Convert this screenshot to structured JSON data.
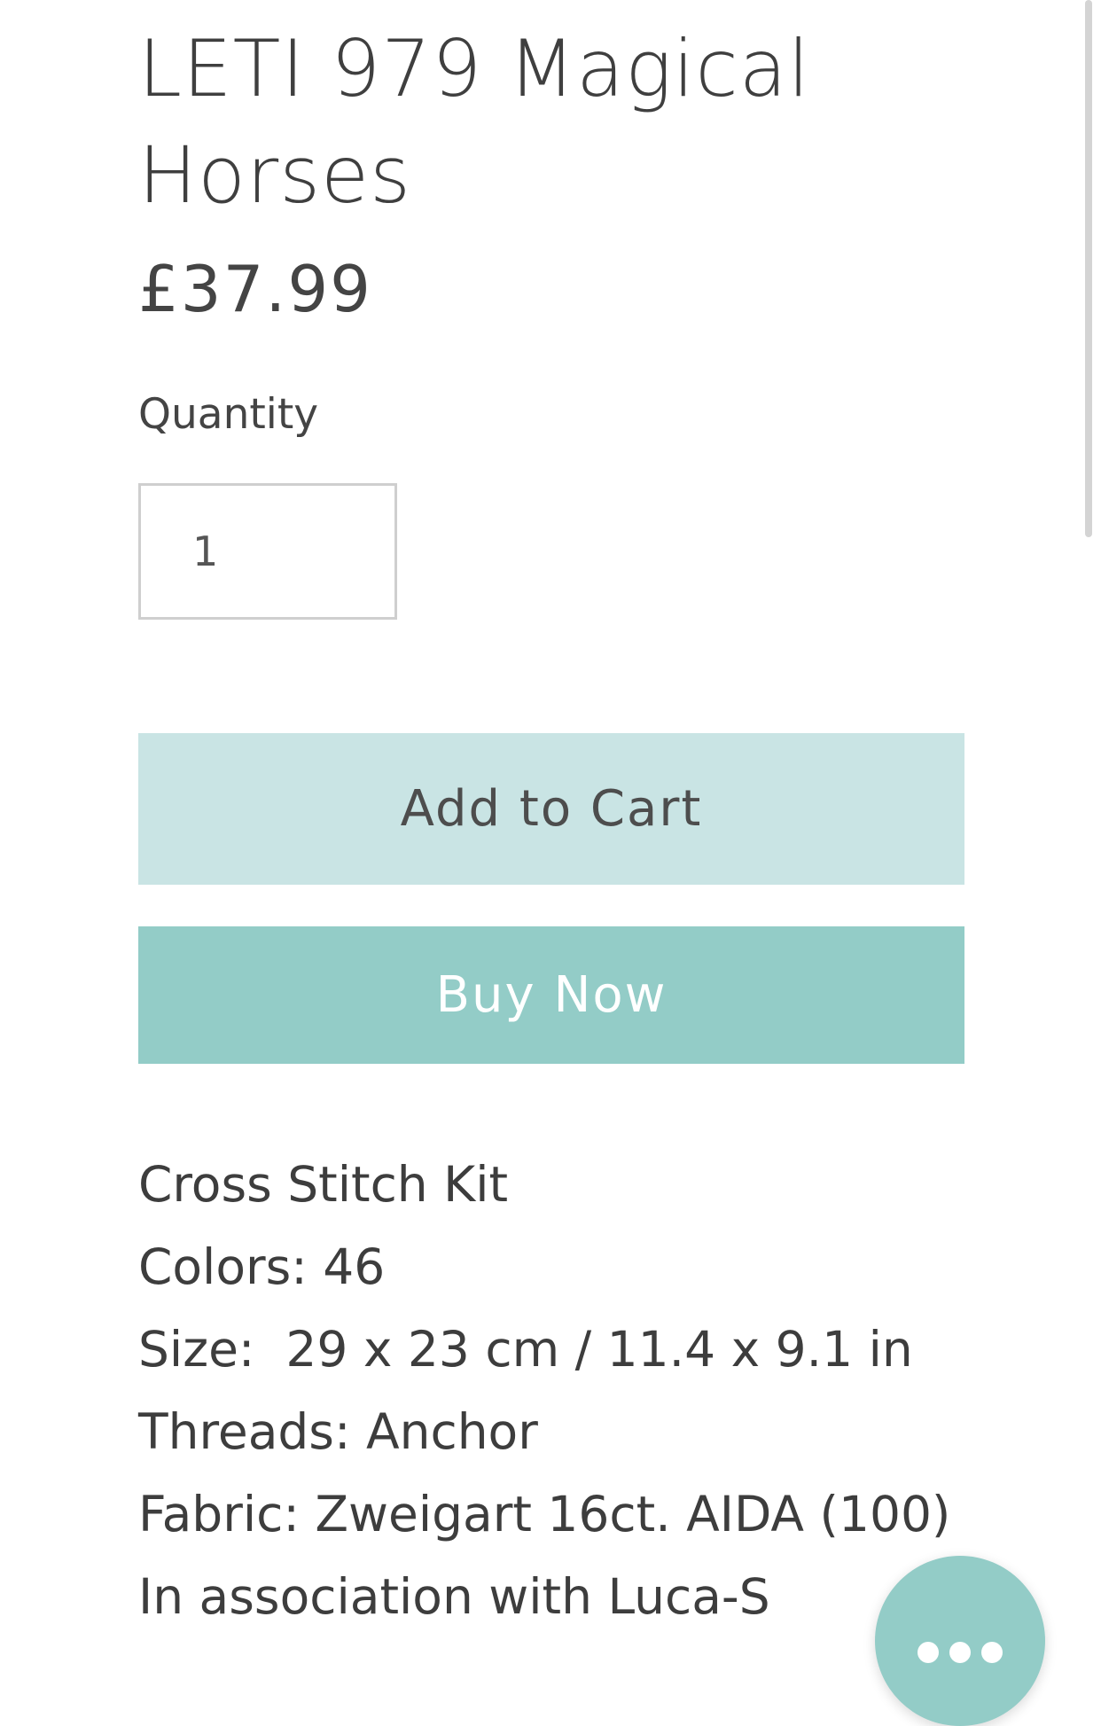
{
  "product": {
    "title": "LETI 979 Magical Horses",
    "price": "£37.99"
  },
  "quantity": {
    "label": "Quantity",
    "value": "1"
  },
  "buttons": {
    "add_to_cart": "Add to Cart",
    "buy_now": "Buy Now"
  },
  "description": [
    "Cross Stitch Kit",
    "Colors: 46",
    "Size:  29 x 23 cm / 11.4 x 9.1 in",
    "Threads: Anchor",
    "Fabric: Zweigart 16ct. AIDA (100)",
    "In association with Luca-S"
  ],
  "colors": {
    "add_to_cart_bg": "#c9e4e4",
    "buy_now_bg": "#93ccc7",
    "chat_fab_bg": "#93ccc7"
  },
  "icons": {
    "chat": "more-dots-icon"
  }
}
